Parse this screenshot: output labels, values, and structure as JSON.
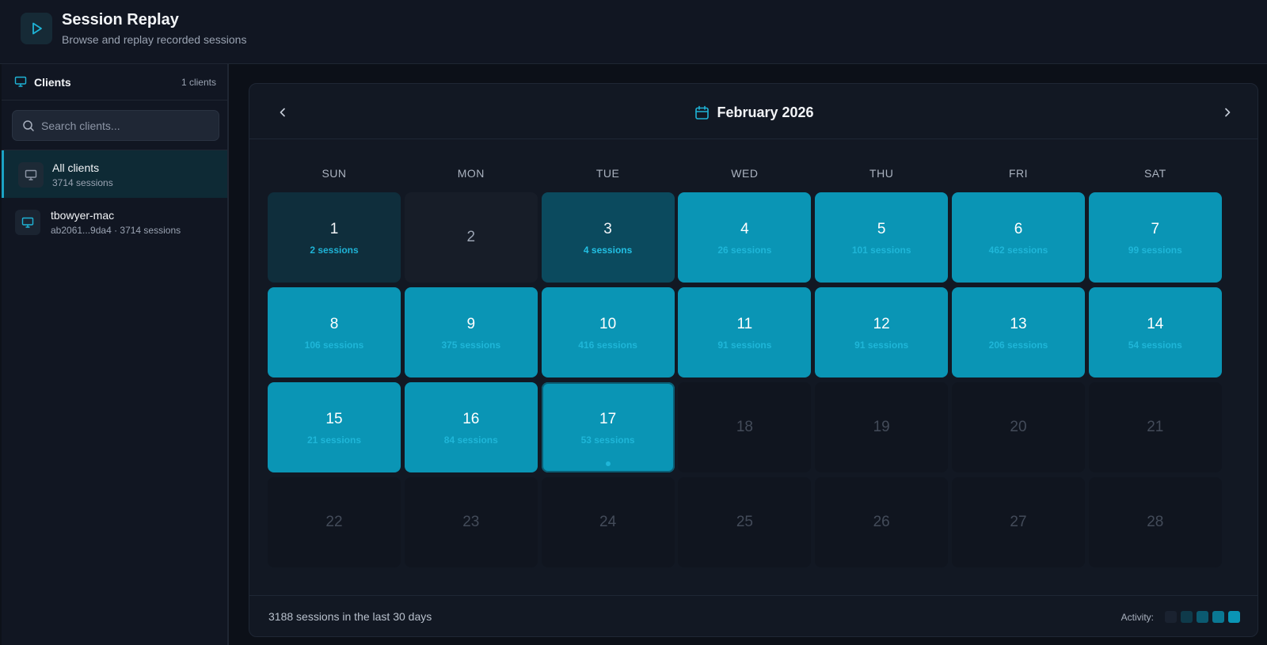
{
  "app": {
    "title": "Session Replay",
    "subtitle": "Browse and replay recorded sessions",
    "icon": "play-icon",
    "accent": "#1ba3c4"
  },
  "sidebar": {
    "title": "Clients",
    "count": "1 clients",
    "search_placeholder": "Search clients...",
    "items": [
      {
        "name": "All clients",
        "sub": "3714 sessions",
        "icon": "monitor-icon",
        "active": true
      },
      {
        "name": "tbowyer-mac",
        "sub": "ab2061...9da4 · 3714 sessions",
        "icon": "monitor-icon",
        "active": false
      }
    ]
  },
  "calendar": {
    "month": "February 2026",
    "weekdays": [
      "SUN",
      "MON",
      "TUE",
      "WED",
      "THU",
      "FRI",
      "SAT"
    ],
    "days": [
      {
        "day": "1",
        "sessions": "2 sessions",
        "level": 1
      },
      {
        "day": "2",
        "sessions": "",
        "level": 0
      },
      {
        "day": "3",
        "sessions": "4 sessions",
        "level": 2
      },
      {
        "day": "4",
        "sessions": "26 sessions",
        "level": 4
      },
      {
        "day": "5",
        "sessions": "101 sessions",
        "level": 4
      },
      {
        "day": "6",
        "sessions": "462 sessions",
        "level": 4
      },
      {
        "day": "7",
        "sessions": "99 sessions",
        "level": 4
      },
      {
        "day": "8",
        "sessions": "106 sessions",
        "level": 4
      },
      {
        "day": "9",
        "sessions": "375 sessions",
        "level": 4
      },
      {
        "day": "10",
        "sessions": "416 sessions",
        "level": 4
      },
      {
        "day": "11",
        "sessions": "91 sessions",
        "level": 4
      },
      {
        "day": "12",
        "sessions": "91 sessions",
        "level": 4
      },
      {
        "day": "13",
        "sessions": "206 sessions",
        "level": 4
      },
      {
        "day": "14",
        "sessions": "54 sessions",
        "level": 4
      },
      {
        "day": "15",
        "sessions": "21 sessions",
        "level": 4
      },
      {
        "day": "16",
        "sessions": "84 sessions",
        "level": 4
      },
      {
        "day": "17",
        "sessions": "53 sessions",
        "level": 4,
        "today": true
      },
      {
        "day": "18",
        "sessions": "",
        "level": -1
      },
      {
        "day": "19",
        "sessions": "",
        "level": -1
      },
      {
        "day": "20",
        "sessions": "",
        "level": -1
      },
      {
        "day": "21",
        "sessions": "",
        "level": -1
      },
      {
        "day": "22",
        "sessions": "",
        "level": -1
      },
      {
        "day": "23",
        "sessions": "",
        "level": -1
      },
      {
        "day": "24",
        "sessions": "",
        "level": -1
      },
      {
        "day": "25",
        "sessions": "",
        "level": -1
      },
      {
        "day": "26",
        "sessions": "",
        "level": -1
      },
      {
        "day": "27",
        "sessions": "",
        "level": -1
      },
      {
        "day": "28",
        "sessions": "",
        "level": -1
      }
    ],
    "footer": "3188 sessions in the last 30 days",
    "legend_label": "Activity:",
    "legend_colors": [
      "#1a2230",
      "#0f3a4a",
      "#0b5a70",
      "#0a7893",
      "#0a95b5"
    ]
  }
}
